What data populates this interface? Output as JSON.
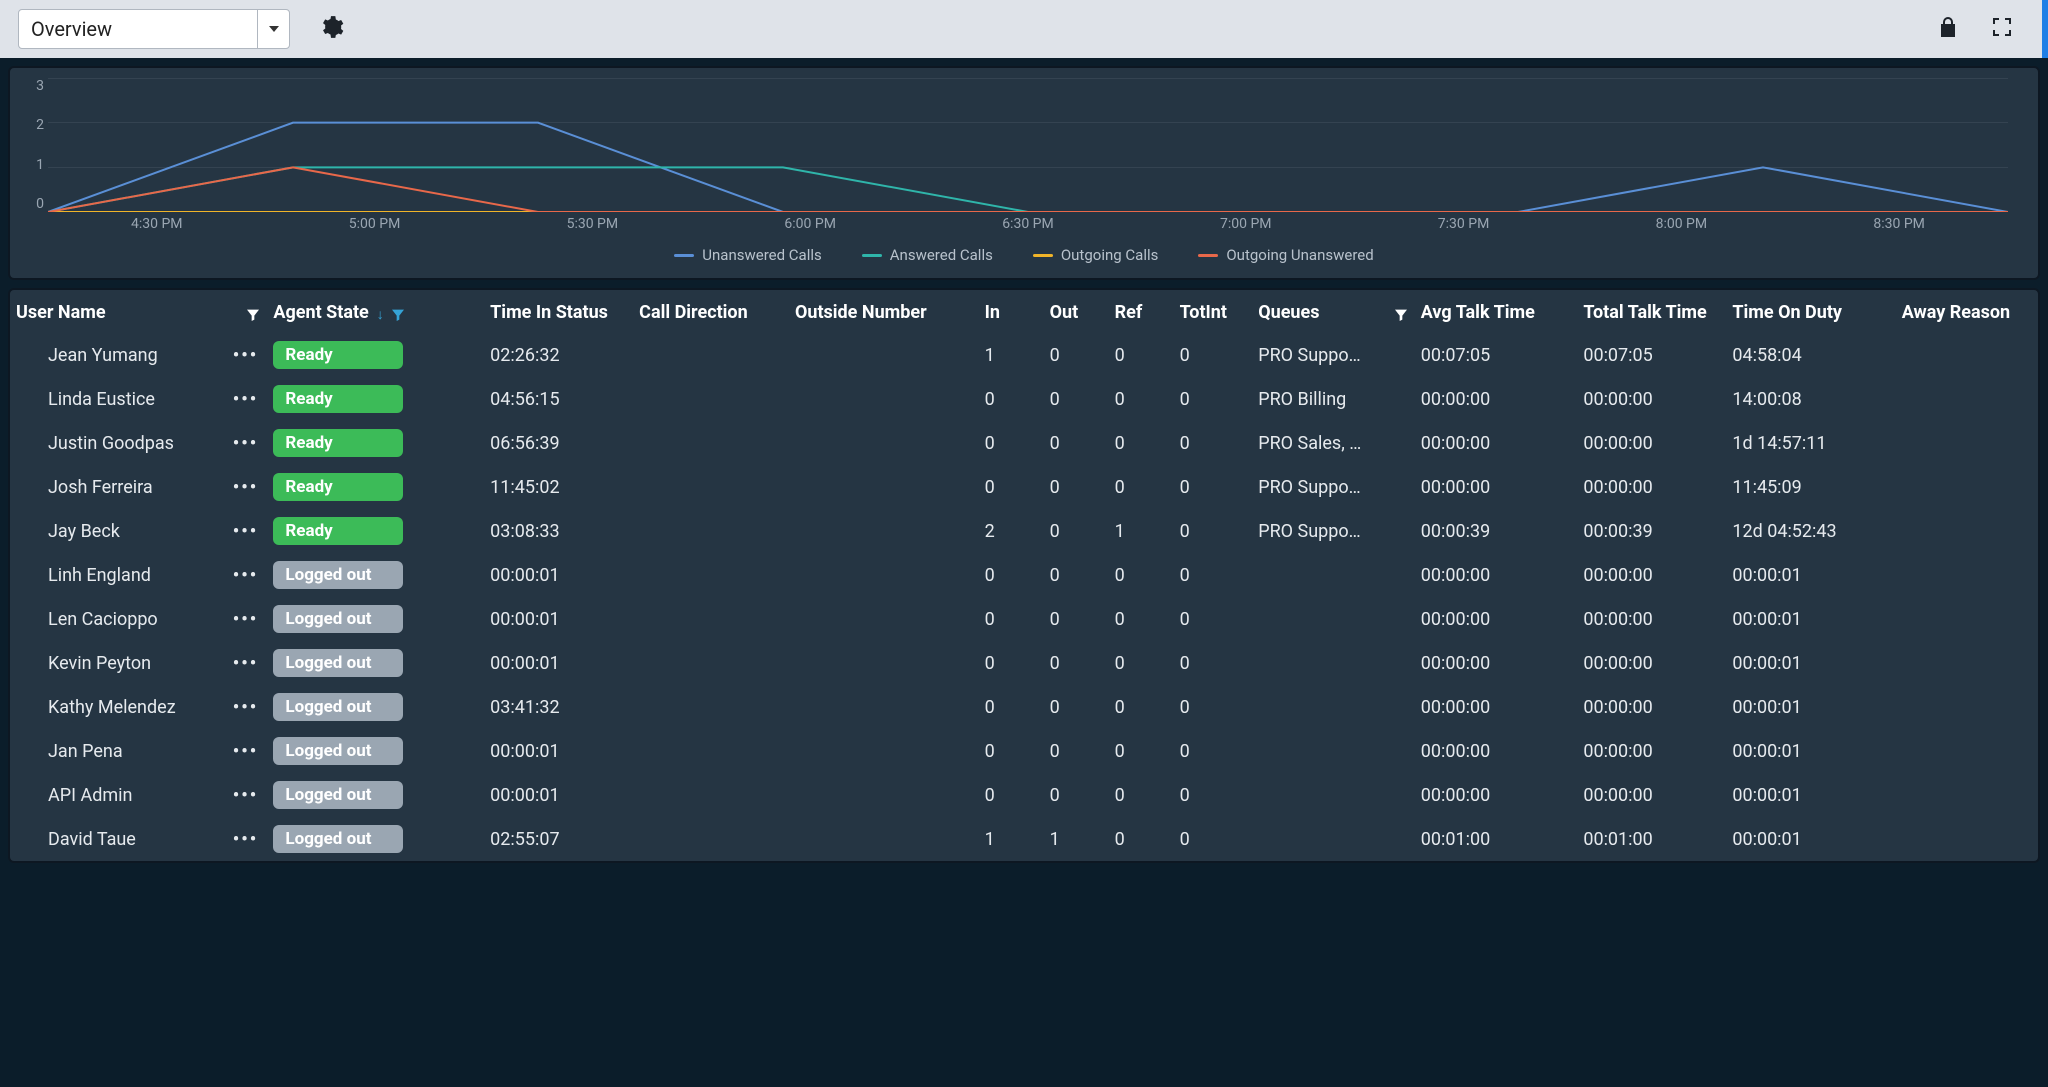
{
  "toolbar": {
    "view_label": "Overview"
  },
  "chart_data": {
    "type": "line",
    "title": "",
    "xlabel": "",
    "ylabel": "",
    "ylim": [
      0,
      3
    ],
    "yticks": [
      0,
      1,
      2,
      3
    ],
    "categories": [
      "4:30 PM",
      "5:00 PM",
      "5:30 PM",
      "6:00 PM",
      "6:30 PM",
      "7:00 PM",
      "7:30 PM",
      "8:00 PM",
      "8:30 PM"
    ],
    "series": [
      {
        "name": "Unanswered Calls",
        "color": "#5a8fd6",
        "values": [
          0,
          2,
          2,
          0,
          0,
          0,
          0,
          1,
          0
        ]
      },
      {
        "name": "Answered Calls",
        "color": "#2fb5aa",
        "values": [
          0,
          1,
          1,
          1,
          0,
          0,
          0,
          0,
          0
        ]
      },
      {
        "name": "Outgoing Calls",
        "color": "#f0b429",
        "values": [
          0,
          0,
          0,
          0,
          0,
          0,
          0,
          0,
          0
        ]
      },
      {
        "name": "Outgoing Unanswered",
        "color": "#e8684a",
        "values": [
          0,
          1,
          0,
          0,
          0,
          0,
          0,
          0,
          0
        ]
      }
    ]
  },
  "table": {
    "headers": {
      "user_name": "User Name",
      "agent_state": "Agent State",
      "time_in_status": "Time In Status",
      "call_direction": "Call Direction",
      "outside_number": "Outside Number",
      "in": "In",
      "out": "Out",
      "ref": "Ref",
      "totint": "TotInt",
      "queues": "Queues",
      "avg_talk": "Avg Talk Time",
      "total_talk": "Total Talk Time",
      "time_on_duty": "Time On Duty",
      "away_reason": "Away Reason"
    },
    "rows": [
      {
        "user": "Jean Yumang",
        "state": "Ready",
        "tis": "02:26:32",
        "dir": "",
        "outside": "",
        "in": 1,
        "out": 0,
        "ref": 0,
        "totint": 0,
        "queues": "PRO Suppo…",
        "avg": "00:07:05",
        "ttt": "00:07:05",
        "duty": "04:58:04",
        "away": ""
      },
      {
        "user": "Linda Eustice",
        "state": "Ready",
        "tis": "04:56:15",
        "dir": "",
        "outside": "",
        "in": 0,
        "out": 0,
        "ref": 0,
        "totint": 0,
        "queues": "PRO Billing",
        "avg": "00:00:00",
        "ttt": "00:00:00",
        "duty": "14:00:08",
        "away": ""
      },
      {
        "user": "Justin Goodpas",
        "state": "Ready",
        "tis": "06:56:39",
        "dir": "",
        "outside": "",
        "in": 0,
        "out": 0,
        "ref": 0,
        "totint": 0,
        "queues": "PRO Sales, …",
        "avg": "00:00:00",
        "ttt": "00:00:00",
        "duty": "1d 14:57:11",
        "away": ""
      },
      {
        "user": "Josh Ferreira",
        "state": "Ready",
        "tis": "11:45:02",
        "dir": "",
        "outside": "",
        "in": 0,
        "out": 0,
        "ref": 0,
        "totint": 0,
        "queues": "PRO Suppo…",
        "avg": "00:00:00",
        "ttt": "00:00:00",
        "duty": "11:45:09",
        "away": ""
      },
      {
        "user": "Jay Beck",
        "state": "Ready",
        "tis": "03:08:33",
        "dir": "",
        "outside": "",
        "in": 2,
        "out": 0,
        "ref": 1,
        "totint": 0,
        "queues": "PRO Suppo…",
        "avg": "00:00:39",
        "ttt": "00:00:39",
        "duty": "12d 04:52:43",
        "away": ""
      },
      {
        "user": "Linh England",
        "state": "Logged out",
        "tis": "00:00:01",
        "dir": "",
        "outside": "",
        "in": 0,
        "out": 0,
        "ref": 0,
        "totint": 0,
        "queues": "",
        "avg": "00:00:00",
        "ttt": "00:00:00",
        "duty": "00:00:01",
        "away": ""
      },
      {
        "user": "Len Cacioppo",
        "state": "Logged out",
        "tis": "00:00:01",
        "dir": "",
        "outside": "",
        "in": 0,
        "out": 0,
        "ref": 0,
        "totint": 0,
        "queues": "",
        "avg": "00:00:00",
        "ttt": "00:00:00",
        "duty": "00:00:01",
        "away": ""
      },
      {
        "user": "Kevin Peyton",
        "state": "Logged out",
        "tis": "00:00:01",
        "dir": "",
        "outside": "",
        "in": 0,
        "out": 0,
        "ref": 0,
        "totint": 0,
        "queues": "",
        "avg": "00:00:00",
        "ttt": "00:00:00",
        "duty": "00:00:01",
        "away": ""
      },
      {
        "user": "Kathy Melendez",
        "state": "Logged out",
        "tis": "03:41:32",
        "dir": "",
        "outside": "",
        "in": 0,
        "out": 0,
        "ref": 0,
        "totint": 0,
        "queues": "",
        "avg": "00:00:00",
        "ttt": "00:00:00",
        "duty": "00:00:01",
        "away": ""
      },
      {
        "user": "Jan Pena",
        "state": "Logged out",
        "tis": "00:00:01",
        "dir": "",
        "outside": "",
        "in": 0,
        "out": 0,
        "ref": 0,
        "totint": 0,
        "queues": "",
        "avg": "00:00:00",
        "ttt": "00:00:00",
        "duty": "00:00:01",
        "away": ""
      },
      {
        "user": "API Admin",
        "state": "Logged out",
        "tis": "00:00:01",
        "dir": "",
        "outside": "",
        "in": 0,
        "out": 0,
        "ref": 0,
        "totint": 0,
        "queues": "",
        "avg": "00:00:00",
        "ttt": "00:00:00",
        "duty": "00:00:01",
        "away": ""
      },
      {
        "user": "David Taue",
        "state": "Logged out",
        "tis": "02:55:07",
        "dir": "",
        "outside": "",
        "in": 1,
        "out": 1,
        "ref": 0,
        "totint": 0,
        "queues": "",
        "avg": "00:01:00",
        "ttt": "00:01:00",
        "duty": "00:00:01",
        "away": ""
      }
    ]
  }
}
